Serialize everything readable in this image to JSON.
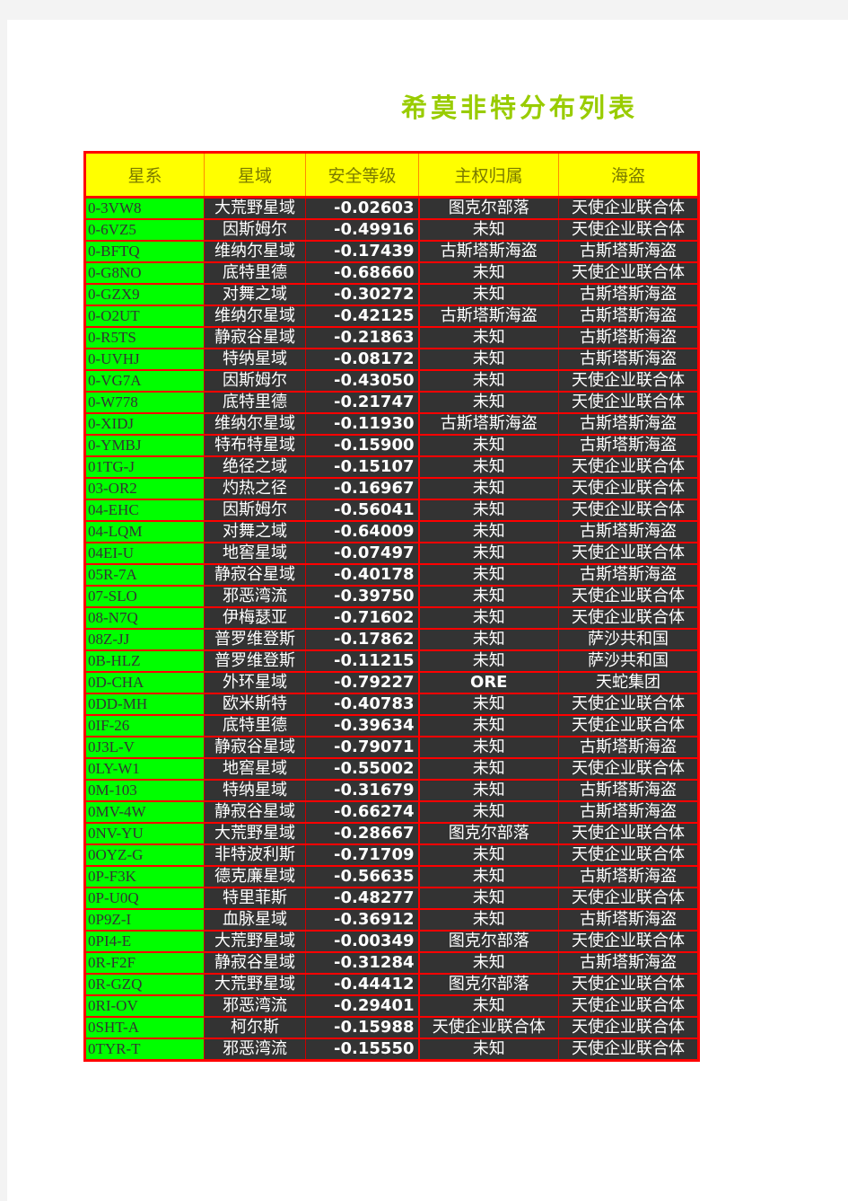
{
  "document": {
    "title": "希莫非特分布列表"
  },
  "table": {
    "headers": [
      "星系",
      "星域",
      "安全等级",
      "主权归属",
      "海盗"
    ],
    "rows": [
      {
        "system": "0-3VW8",
        "region": "大荒野星域",
        "security": "-0.02603",
        "sovereignty": "图克尔部落",
        "pirates": "天使企业联合体"
      },
      {
        "system": "0-6VZ5",
        "region": "因斯姆尔",
        "security": "-0.49916",
        "sovereignty": "未知",
        "pirates": "天使企业联合体"
      },
      {
        "system": "0-BFTQ",
        "region": "维纳尔星域",
        "security": "-0.17439",
        "sovereignty": "古斯塔斯海盗",
        "pirates": "古斯塔斯海盗"
      },
      {
        "system": "0-G8NO",
        "region": "底特里德",
        "security": "-0.68660",
        "sovereignty": "未知",
        "pirates": "天使企业联合体"
      },
      {
        "system": "0-GZX9",
        "region": "对舞之域",
        "security": "-0.30272",
        "sovereignty": "未知",
        "pirates": "古斯塔斯海盗"
      },
      {
        "system": "0-O2UT",
        "region": "维纳尔星域",
        "security": "-0.42125",
        "sovereignty": "古斯塔斯海盗",
        "pirates": "古斯塔斯海盗"
      },
      {
        "system": "0-R5TS",
        "region": "静寂谷星域",
        "security": "-0.21863",
        "sovereignty": "未知",
        "pirates": "古斯塔斯海盗"
      },
      {
        "system": "0-UVHJ",
        "region": "特纳星域",
        "security": "-0.08172",
        "sovereignty": "未知",
        "pirates": "古斯塔斯海盗"
      },
      {
        "system": "0-VG7A",
        "region": "因斯姆尔",
        "security": "-0.43050",
        "sovereignty": "未知",
        "pirates": "天使企业联合体"
      },
      {
        "system": "0-W778",
        "region": "底特里德",
        "security": "-0.21747",
        "sovereignty": "未知",
        "pirates": "天使企业联合体"
      },
      {
        "system": "0-XIDJ",
        "region": "维纳尔星域",
        "security": "-0.11930",
        "sovereignty": "古斯塔斯海盗",
        "pirates": "古斯塔斯海盗"
      },
      {
        "system": "0-YMBJ",
        "region": "特布特星域",
        "security": "-0.15900",
        "sovereignty": "未知",
        "pirates": "古斯塔斯海盗"
      },
      {
        "system": "01TG-J",
        "region": "绝径之域",
        "security": "-0.15107",
        "sovereignty": "未知",
        "pirates": "天使企业联合体"
      },
      {
        "system": "03-OR2",
        "region": "灼热之径",
        "security": "-0.16967",
        "sovereignty": "未知",
        "pirates": "天使企业联合体"
      },
      {
        "system": "04-EHC",
        "region": "因斯姆尔",
        "security": "-0.56041",
        "sovereignty": "未知",
        "pirates": "天使企业联合体"
      },
      {
        "system": "04-LQM",
        "region": "对舞之域",
        "security": "-0.64009",
        "sovereignty": "未知",
        "pirates": "古斯塔斯海盗"
      },
      {
        "system": "04EI-U",
        "region": "地窖星域",
        "security": "-0.07497",
        "sovereignty": "未知",
        "pirates": "天使企业联合体"
      },
      {
        "system": "05R-7A",
        "region": "静寂谷星域",
        "security": "-0.40178",
        "sovereignty": "未知",
        "pirates": "古斯塔斯海盗"
      },
      {
        "system": "07-SLO",
        "region": "邪恶湾流",
        "security": "-0.39750",
        "sovereignty": "未知",
        "pirates": "天使企业联合体"
      },
      {
        "system": "08-N7Q",
        "region": "伊梅瑟亚",
        "security": "-0.71602",
        "sovereignty": "未知",
        "pirates": "天使企业联合体"
      },
      {
        "system": "08Z-JJ",
        "region": "普罗维登斯",
        "security": "-0.17862",
        "sovereignty": "未知",
        "pirates": "萨沙共和国"
      },
      {
        "system": "0B-HLZ",
        "region": "普罗维登斯",
        "security": "-0.11215",
        "sovereignty": "未知",
        "pirates": "萨沙共和国"
      },
      {
        "system": "0D-CHA",
        "region": "外环星域",
        "security": "-0.79227",
        "sovereignty": "ORE",
        "pirates": "天蛇集团"
      },
      {
        "system": "0DD-MH",
        "region": "欧米斯特",
        "security": "-0.40783",
        "sovereignty": "未知",
        "pirates": "天使企业联合体"
      },
      {
        "system": "0IF-26",
        "region": "底特里德",
        "security": "-0.39634",
        "sovereignty": "未知",
        "pirates": "天使企业联合体"
      },
      {
        "system": "0J3L-V",
        "region": "静寂谷星域",
        "security": "-0.79071",
        "sovereignty": "未知",
        "pirates": "古斯塔斯海盗"
      },
      {
        "system": "0LY-W1",
        "region": "地窖星域",
        "security": "-0.55002",
        "sovereignty": "未知",
        "pirates": "天使企业联合体"
      },
      {
        "system": "0M-103",
        "region": "特纳星域",
        "security": "-0.31679",
        "sovereignty": "未知",
        "pirates": "古斯塔斯海盗"
      },
      {
        "system": "0MV-4W",
        "region": "静寂谷星域",
        "security": "-0.66274",
        "sovereignty": "未知",
        "pirates": "古斯塔斯海盗"
      },
      {
        "system": "0NV-YU",
        "region": "大荒野星域",
        "security": "-0.28667",
        "sovereignty": "图克尔部落",
        "pirates": "天使企业联合体"
      },
      {
        "system": "0OYZ-G",
        "region": "非特波利斯",
        "security": "-0.71709",
        "sovereignty": "未知",
        "pirates": "天使企业联合体"
      },
      {
        "system": "0P-F3K",
        "region": "德克廉星域",
        "security": "-0.56635",
        "sovereignty": "未知",
        "pirates": "古斯塔斯海盗"
      },
      {
        "system": "0P-U0Q",
        "region": "特里菲斯",
        "security": "-0.48277",
        "sovereignty": "未知",
        "pirates": "天使企业联合体"
      },
      {
        "system": "0P9Z-I",
        "region": "血脉星域",
        "security": "-0.36912",
        "sovereignty": "未知",
        "pirates": "古斯塔斯海盗"
      },
      {
        "system": "0PI4-E",
        "region": "大荒野星域",
        "security": "-0.00349",
        "sovereignty": "图克尔部落",
        "pirates": "天使企业联合体"
      },
      {
        "system": "0R-F2F",
        "region": "静寂谷星域",
        "security": "-0.31284",
        "sovereignty": "未知",
        "pirates": "古斯塔斯海盗"
      },
      {
        "system": "0R-GZQ",
        "region": "大荒野星域",
        "security": "-0.44412",
        "sovereignty": "图克尔部落",
        "pirates": "天使企业联合体"
      },
      {
        "system": "0RI-OV",
        "region": "邪恶湾流",
        "security": "-0.29401",
        "sovereignty": "未知",
        "pirates": "天使企业联合体"
      },
      {
        "system": "0SHT-A",
        "region": "柯尔斯",
        "security": "-0.15988",
        "sovereignty": "天使企业联合体",
        "pirates": "天使企业联合体"
      },
      {
        "system": "0TYR-T",
        "region": "邪恶湾流",
        "security": "-0.15550",
        "sovereignty": "未知",
        "pirates": "天使企业联合体"
      }
    ]
  },
  "colors": {
    "title": "#99cc00",
    "header_bg": "#ffff00",
    "border": "#ff0000",
    "system_cell_bg": "#00ff00",
    "data_cell_bg": "#333333"
  }
}
